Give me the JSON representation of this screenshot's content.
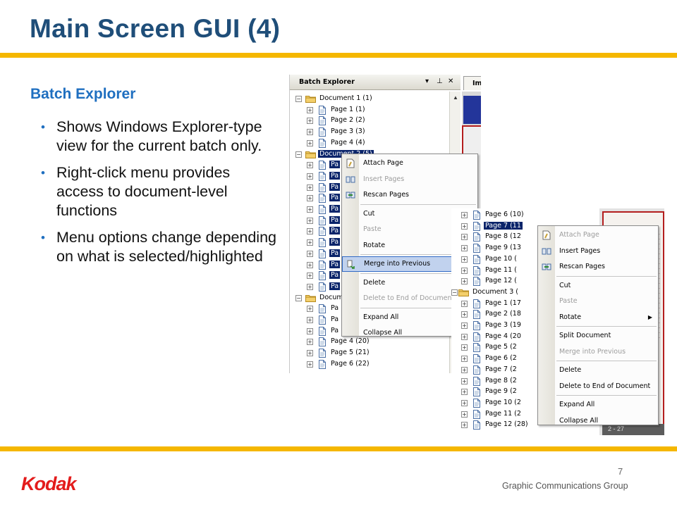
{
  "slide": {
    "title": "Main Screen GUI  (4)",
    "subheading": "Batch Explorer",
    "bullets": [
      "Shows Windows Explorer-type view for the current batch only.",
      "Right-click menu provides access to document-level functions",
      "Menu options change depending on what is selected/highlighted"
    ],
    "page_number": "7",
    "footer_text": "Graphic Communications Group",
    "logo_text": "Kodak"
  },
  "colors": {
    "title": "#1f4e79",
    "accent_rule": "#f5b700",
    "subhead": "#1f6fc0",
    "selection": "#0a246a",
    "logo": "#e31b1b"
  },
  "panel1": {
    "title": "Batch Explorer",
    "tab_label": "Im",
    "title_controls": [
      "chevron-down-icon",
      "pin-icon",
      "close-icon"
    ],
    "tree": [
      {
        "label": "Document 1 (1)",
        "type": "doc",
        "selected": false
      },
      {
        "label": "Page 1 (1)",
        "type": "page",
        "selected": false
      },
      {
        "label": "Page 2 (2)",
        "type": "page",
        "selected": false
      },
      {
        "label": "Page 3 (3)",
        "type": "page",
        "selected": false
      },
      {
        "label": "Page 4 (4)",
        "type": "page",
        "selected": false
      },
      {
        "label": "Document 2 (5)",
        "type": "doc",
        "selected": true
      },
      {
        "label": "Pa",
        "type": "page",
        "selected": true
      },
      {
        "label": "Pa",
        "type": "page",
        "selected": true
      },
      {
        "label": "Pa",
        "type": "page",
        "selected": true
      },
      {
        "label": "Pa",
        "type": "page",
        "selected": true
      },
      {
        "label": "Pa",
        "type": "page",
        "selected": true
      },
      {
        "label": "Pa",
        "type": "page",
        "selected": true
      },
      {
        "label": "Pa",
        "type": "page",
        "selected": true
      },
      {
        "label": "Pa",
        "type": "page",
        "selected": true
      },
      {
        "label": "Pa",
        "type": "page",
        "selected": true
      },
      {
        "label": "Pa",
        "type": "page",
        "selected": true
      },
      {
        "label": "Pa",
        "type": "page",
        "selected": true
      },
      {
        "label": "Pa",
        "type": "page",
        "selected": true
      },
      {
        "label": "Docum",
        "type": "doc",
        "selected": false
      },
      {
        "label": "Pa",
        "type": "page",
        "selected": false
      },
      {
        "label": "Pa",
        "type": "page",
        "selected": false
      },
      {
        "label": "Pa",
        "type": "page",
        "selected": false
      },
      {
        "label": "Page 4 (20)",
        "type": "page",
        "selected": false
      },
      {
        "label": "Page 5 (21)",
        "type": "page",
        "selected": false
      },
      {
        "label": "Page 6 (22)",
        "type": "page",
        "selected": false
      }
    ],
    "menu": [
      {
        "label": "Attach Page",
        "icon": "attach-page-icon",
        "disabled": false
      },
      {
        "label": "Insert Pages",
        "icon": "insert-pages-icon",
        "disabled": true
      },
      {
        "label": "Rescan Pages",
        "icon": "rescan-pages-icon",
        "disabled": false
      },
      {
        "sep": true
      },
      {
        "label": "Cut",
        "disabled": false
      },
      {
        "label": "Paste",
        "disabled": true
      },
      {
        "label": "Rotate",
        "disabled": false
      },
      {
        "sep": true
      },
      {
        "label": "Merge into Previous",
        "icon": "merge-icon",
        "disabled": false,
        "highlight": true
      },
      {
        "sep": true
      },
      {
        "label": "Delete",
        "disabled": false
      },
      {
        "label": "Delete to End of Document",
        "disabled": true
      },
      {
        "sep": true
      },
      {
        "label": "Expand All",
        "disabled": false
      },
      {
        "label": "Collapse All",
        "disabled": false
      }
    ]
  },
  "panel2": {
    "footer_label": "2 - 27",
    "tree": [
      {
        "label": "Page 6 (10)",
        "type": "page",
        "selected": false
      },
      {
        "label": "Page 7 (11",
        "type": "page",
        "selected": true
      },
      {
        "label": "Page 8 (12",
        "type": "page",
        "selected": false
      },
      {
        "label": "Page 9 (13",
        "type": "page",
        "selected": false
      },
      {
        "label": "Page 10 (",
        "type": "page",
        "selected": false
      },
      {
        "label": "Page 11 (",
        "type": "page",
        "selected": false
      },
      {
        "label": "Page 12 (",
        "type": "page",
        "selected": false
      },
      {
        "label": "Document 3 (",
        "type": "doc",
        "selected": false
      },
      {
        "label": "Page 1 (17",
        "type": "page",
        "selected": false
      },
      {
        "label": "Page 2 (18",
        "type": "page",
        "selected": false
      },
      {
        "label": "Page 3 (19",
        "type": "page",
        "selected": false
      },
      {
        "label": "Page 4 (20",
        "type": "page",
        "selected": false
      },
      {
        "label": "Page 5 (2",
        "type": "page",
        "selected": false
      },
      {
        "label": "Page 6 (2",
        "type": "page",
        "selected": false
      },
      {
        "label": "Page 7 (2",
        "type": "page",
        "selected": false
      },
      {
        "label": "Page 8 (2",
        "type": "page",
        "selected": false
      },
      {
        "label": "Page 9 (2",
        "type": "page",
        "selected": false
      },
      {
        "label": "Page 10 (2",
        "type": "page",
        "selected": false
      },
      {
        "label": "Page 11 (2",
        "type": "page",
        "selected": false
      },
      {
        "label": "Page 12 (28)",
        "type": "page",
        "selected": false
      }
    ],
    "menu": [
      {
        "label": "Attach Page",
        "icon": "attach-page-icon",
        "disabled": true
      },
      {
        "label": "Insert Pages",
        "icon": "insert-pages-icon",
        "disabled": false
      },
      {
        "label": "Rescan Pages",
        "icon": "rescan-pages-icon",
        "disabled": false
      },
      {
        "sep": true
      },
      {
        "label": "Cut",
        "disabled": false
      },
      {
        "label": "Paste",
        "disabled": true
      },
      {
        "label": "Rotate",
        "disabled": false,
        "submenu": true
      },
      {
        "sep": true
      },
      {
        "label": "Split Document",
        "disabled": false
      },
      {
        "label": "Merge into Previous",
        "disabled": true
      },
      {
        "sep": true
      },
      {
        "label": "Delete",
        "disabled": false
      },
      {
        "label": "Delete to End of Document",
        "disabled": false
      },
      {
        "sep": true
      },
      {
        "label": "Expand All",
        "disabled": false
      },
      {
        "label": "Collapse All",
        "disabled": false
      }
    ]
  }
}
